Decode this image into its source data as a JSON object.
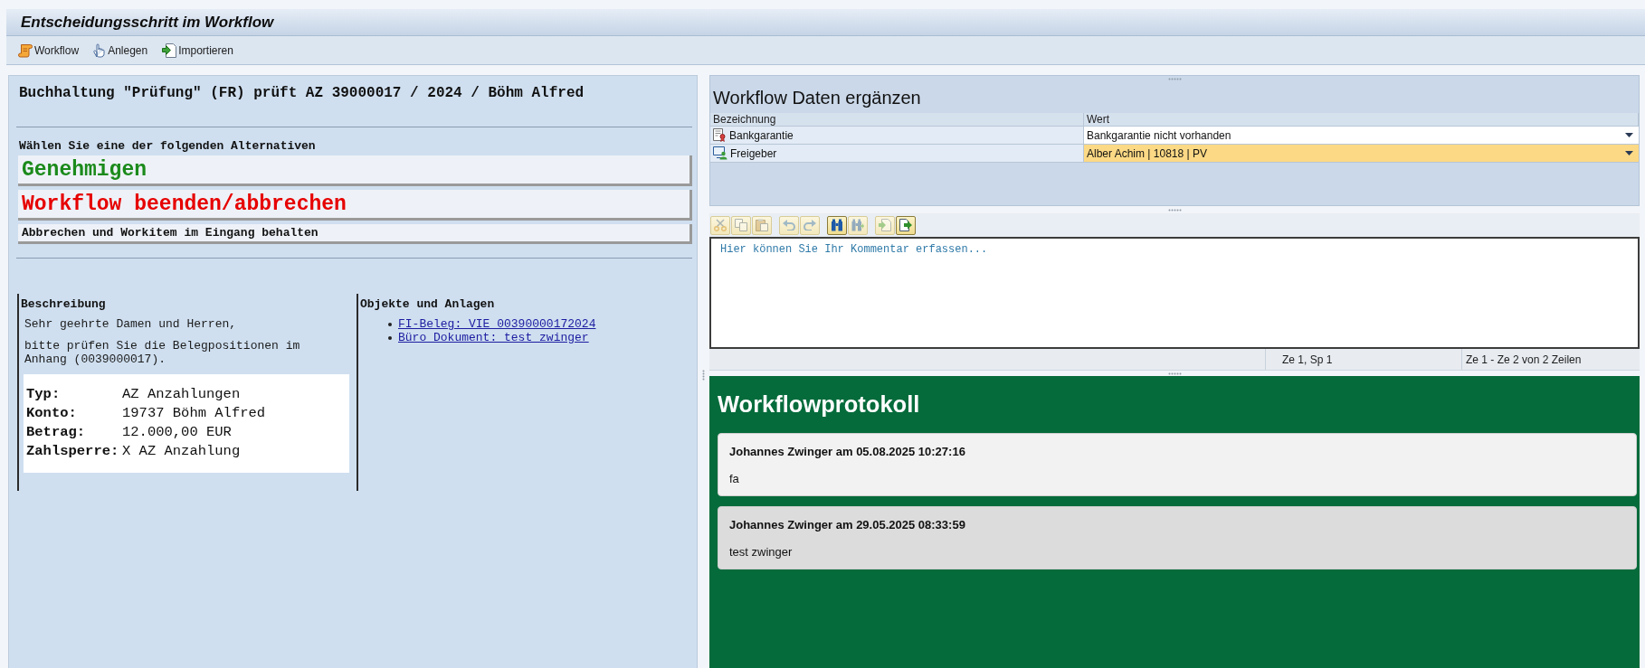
{
  "window": {
    "title": "Entscheidungsschritt im Workflow"
  },
  "toolbar": [
    {
      "kind": "workflow",
      "label": "Workflow"
    },
    {
      "kind": "attach",
      "label": "Anlegen"
    },
    {
      "kind": "import",
      "label": "Importieren"
    }
  ],
  "decision": {
    "heading": "Buchhaltung \"Prüfung\" (FR) prüft AZ 39000017 / 2024 / Böhm Alfred",
    "prompt": "Wählen Sie eine der folgenden Alternativen",
    "alternatives": [
      {
        "kind": "approve",
        "label": "Genehmigen"
      },
      {
        "kind": "cancel",
        "label": "Workflow beenden/abbrechen"
      },
      {
        "kind": "keep",
        "label": "Abbrechen und Workitem im Eingang behalten"
      }
    ]
  },
  "description": {
    "heading": "Beschreibung",
    "paragraphs": [
      "Sehr geehrte Damen und Herren,",
      "bitte prüfen Sie die Belegpositionen im Anhang (0039000017)."
    ],
    "details": [
      {
        "label": "Typ:",
        "value": "AZ Anzahlungen"
      },
      {
        "label": "Konto:",
        "value": "19737 Böhm Alfred"
      },
      {
        "label": "Betrag:",
        "value": "12.000,00 EUR"
      },
      {
        "label": "Zahlsperre:",
        "value": "X AZ Anzahlung"
      }
    ]
  },
  "objects": {
    "heading": "Objekte und Anlagen",
    "links": [
      "FI-Beleg: VIE 00390000172024",
      "Büro Dokument: test_zwinger"
    ]
  },
  "data_form": {
    "title": "Workflow Daten ergänzen",
    "columns": [
      "Bezeichnung",
      "Wert"
    ],
    "rows": [
      {
        "kind": "certificate",
        "label": "Bankgarantie",
        "value": "Bankgarantie nicht vorhanden",
        "selected": false
      },
      {
        "kind": "approver",
        "label": "Freigeber",
        "value": "Alber Achim | 10818 | PV",
        "selected": true
      }
    ]
  },
  "editor": {
    "tool_groups": [
      [
        {
          "kind": "cut",
          "disabled": true
        },
        {
          "kind": "copy",
          "disabled": true
        },
        {
          "kind": "paste",
          "disabled": true
        }
      ],
      [
        {
          "kind": "undo",
          "disabled": true
        },
        {
          "kind": "redo",
          "disabled": true
        }
      ],
      [
        {
          "kind": "find",
          "disabled": false
        },
        {
          "kind": "find_next",
          "disabled": true
        }
      ],
      [
        {
          "kind": "import",
          "disabled": true
        },
        {
          "kind": "export",
          "disabled": false
        }
      ]
    ],
    "placeholder": "Hier können Sie Ihr Kommentar erfassen...",
    "status": [
      "Ze 1, Sp 1",
      "Ze 1 - Ze 2 von 2 Zeilen"
    ]
  },
  "log": {
    "title": "Workflowprotokoll",
    "entries": [
      {
        "header": "Johannes Zwinger am 05.08.2025 10:27:16",
        "text": "fa"
      },
      {
        "header": "Johannes Zwinger am 29.05.2025 08:33:59",
        "text": "test zwinger"
      }
    ]
  }
}
